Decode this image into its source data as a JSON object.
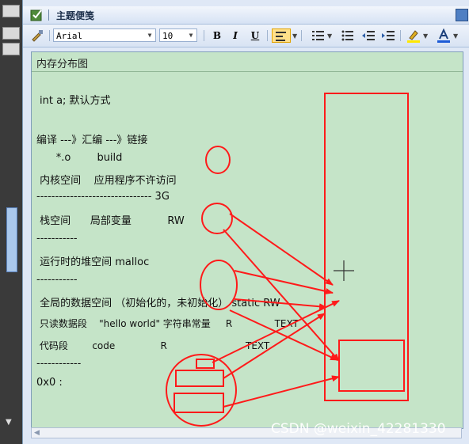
{
  "window": {
    "title": "主题便笺"
  },
  "toolbar": {
    "font_name": "Arial",
    "font_size": "10",
    "bold_label": "B",
    "italic_label": "I",
    "underline_label": "U"
  },
  "note": {
    "header": "内存分布图",
    "lines": [
      "int a; 默认方式",
      "编译 ---》汇编 ---》链接",
      "      *.o        build",
      " 内核空间    应用程序不许访问",
      "------------------------------- 3G",
      " 栈空间      局部变量           RW",
      "-----------",
      " 运行时的堆空间 malloc",
      "-----------",
      " 全局的数据空间 （初始化的，未初始化） static RW",
      " 只读数据段    \"hello world\" 字符串常量     R              TEXT",
      " 代码段        code               R                          TEXT",
      "------------",
      "0x0 :"
    ]
  },
  "watermark": "CSDN @weixin_42281330",
  "colors": {
    "editor_bg": "#c5e4c8",
    "annotation": "#ff1a1a",
    "highlight_button": "#ffe08a"
  }
}
